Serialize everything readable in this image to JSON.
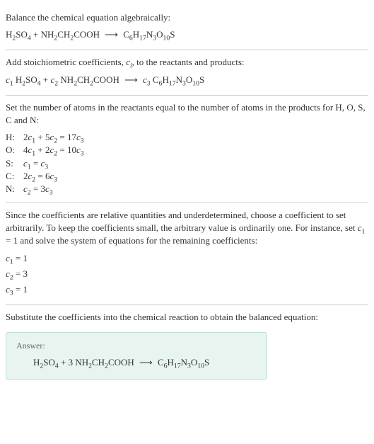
{
  "section1": {
    "title": "Balance the chemical equation algebraically:",
    "equation_lhs1": "H",
    "equation_sub1": "2",
    "equation_lhs2": "SO",
    "equation_sub2": "4",
    "plus1": " + ",
    "equation_lhs3": "NH",
    "equation_sub3": "2",
    "equation_lhs4": "CH",
    "equation_sub4": "2",
    "equation_lhs5": "COOH",
    "arrow": " ⟶ ",
    "equation_rhs1": "C",
    "equation_rsub1": "6",
    "equation_rhs2": "H",
    "equation_rsub2": "17",
    "equation_rhs3": "N",
    "equation_rsub3": "3",
    "equation_rhs4": "O",
    "equation_rsub4": "10",
    "equation_rhs5": "S"
  },
  "section2": {
    "title_part1": "Add stoichiometric coefficients, ",
    "ci": "c",
    "ci_sub": "i",
    "title_part2": ", to the reactants and products:",
    "c1": "c",
    "c1_sub": "1",
    "sp1": " ",
    "lhs1": "H",
    "sub1": "2",
    "lhs2": "SO",
    "sub2": "4",
    "plus1": " + ",
    "c2": "c",
    "c2_sub": "2",
    "sp2": " ",
    "lhs3": "NH",
    "sub3": "2",
    "lhs4": "CH",
    "sub4": "2",
    "lhs5": "COOH",
    "arrow": " ⟶ ",
    "c3": "c",
    "c3_sub": "3",
    "sp3": " ",
    "rhs1": "C",
    "rsub1": "6",
    "rhs2": "H",
    "rsub2": "17",
    "rhs3": "N",
    "rsub3": "3",
    "rhs4": "O",
    "rsub4": "10",
    "rhs5": "S"
  },
  "section3": {
    "title": "Set the number of atoms in the reactants equal to the number of atoms in the products for H, O, S, C and N:",
    "rows": [
      {
        "label": "H:",
        "eq_p1": "2",
        "eq_c1": "c",
        "eq_s1": "1",
        "eq_p2": " + 5",
        "eq_c2": "c",
        "eq_s2": "2",
        "eq_p3": " = 17",
        "eq_c3": "c",
        "eq_s3": "3"
      },
      {
        "label": "O:",
        "eq_p1": "4",
        "eq_c1": "c",
        "eq_s1": "1",
        "eq_p2": " + 2",
        "eq_c2": "c",
        "eq_s2": "2",
        "eq_p3": " = 10",
        "eq_c3": "c",
        "eq_s3": "3"
      },
      {
        "label": "S:",
        "eq_p1": "",
        "eq_c1": "c",
        "eq_s1": "1",
        "eq_p2": "",
        "eq_c2": "",
        "eq_s2": "",
        "eq_p3": " = ",
        "eq_c3": "c",
        "eq_s3": "3"
      },
      {
        "label": "C:",
        "eq_p1": "2",
        "eq_c1": "c",
        "eq_s1": "2",
        "eq_p2": "",
        "eq_c2": "",
        "eq_s2": "",
        "eq_p3": " = 6",
        "eq_c3": "c",
        "eq_s3": "3"
      },
      {
        "label": "N:",
        "eq_p1": "",
        "eq_c1": "c",
        "eq_s1": "2",
        "eq_p2": "",
        "eq_c2": "",
        "eq_s2": "",
        "eq_p3": " = 3",
        "eq_c3": "c",
        "eq_s3": "3"
      }
    ]
  },
  "section4": {
    "title_p1": "Since the coefficients are relative quantities and underdetermined, choose a coefficient to set arbitrarily. To keep the coefficients small, the arbitrary value is ordinarily one. For instance, set ",
    "title_c": "c",
    "title_s": "1",
    "title_p2": " = 1 and solve the system of equations for the remaining coefficients:",
    "r1_c": "c",
    "r1_s": "1",
    "r1_v": " = 1",
    "r2_c": "c",
    "r2_s": "2",
    "r2_v": " = 3",
    "r3_c": "c",
    "r3_s": "3",
    "r3_v": " = 1"
  },
  "section5": {
    "title": "Substitute the coefficients into the chemical reaction to obtain the balanced equation:",
    "answer_label": "Answer:",
    "lhs1": "H",
    "sub1": "2",
    "lhs2": "SO",
    "sub2": "4",
    "plus1": " + 3 ",
    "lhs3": "NH",
    "sub3": "2",
    "lhs4": "CH",
    "sub4": "2",
    "lhs5": "COOH",
    "arrow": " ⟶ ",
    "rhs1": "C",
    "rsub1": "6",
    "rhs2": "H",
    "rsub2": "17",
    "rhs3": "N",
    "rsub3": "3",
    "rhs4": "O",
    "rsub4": "10",
    "rhs5": "S"
  }
}
